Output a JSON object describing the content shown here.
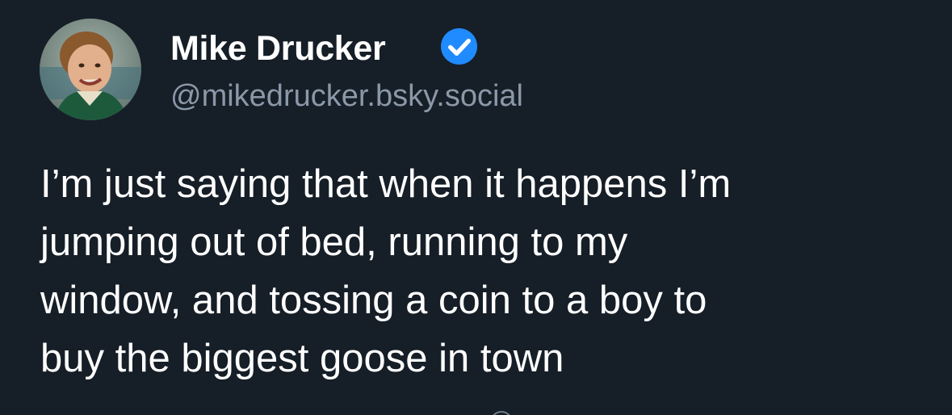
{
  "post": {
    "author": {
      "name": "Mike Drucker",
      "handle": "@mikedrucker.bsky.social",
      "verified": true,
      "avatar_icon": "child-portrait-avatar"
    },
    "text_lines": [
      "I’m just saying that when it happens I’m",
      "jumping out of bed, running to my",
      "window, and tossing a coin to a boy to",
      "buy the biggest goose in town"
    ]
  },
  "colors": {
    "background": "#161e27",
    "text": "#ffffff",
    "handle": "#8b98a8",
    "verified_badge": "#208bfe"
  }
}
